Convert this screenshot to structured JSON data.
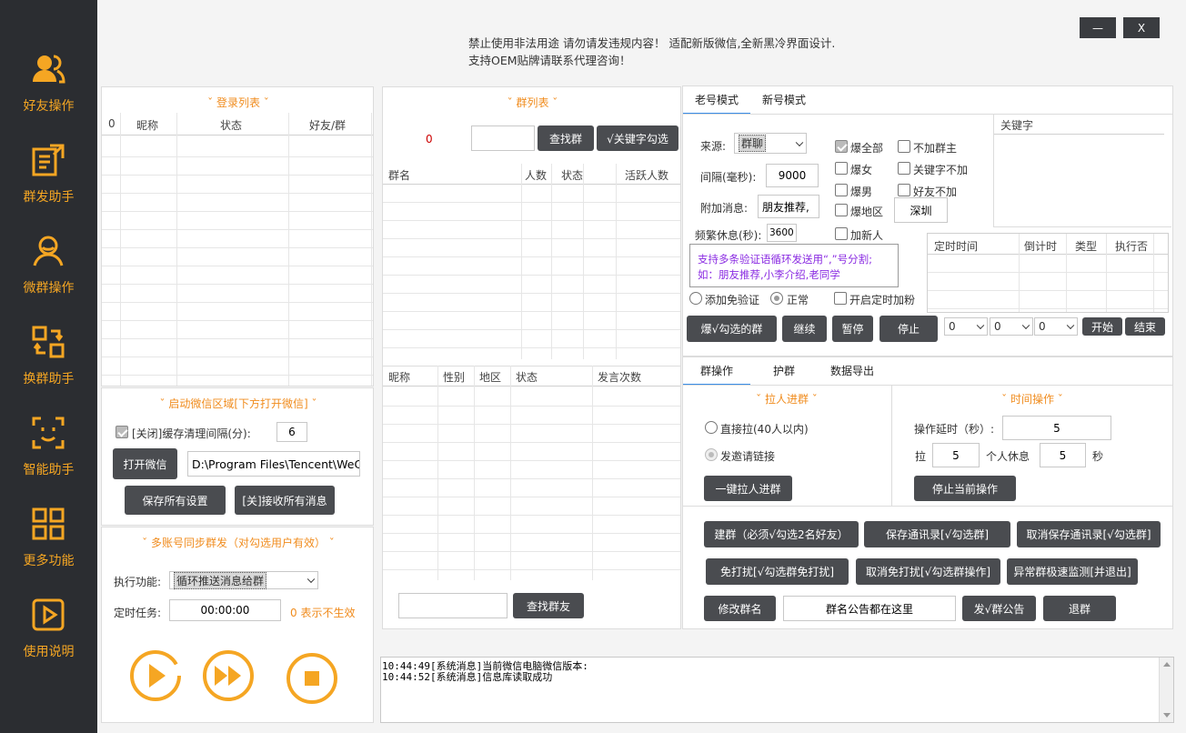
{
  "sidebar": {
    "items": [
      {
        "label": "好友操作",
        "icon": "users-icon"
      },
      {
        "label": "群发助手",
        "icon": "broadcast-icon"
      },
      {
        "label": "微群操作",
        "icon": "group-icon"
      },
      {
        "label": "换群助手",
        "icon": "swap-icon"
      },
      {
        "label": "智能助手",
        "icon": "smart-icon"
      },
      {
        "label": "更多功能",
        "icon": "grid-icon"
      },
      {
        "label": "使用说明",
        "icon": "play-icon"
      }
    ]
  },
  "header": {
    "notice_line1": "禁止使用非法用途 请勿请发违规内容！ 适配新版微信,全新黑冷界面设计.",
    "notice_line2": "支持OEM贴牌请联系代理咨询！",
    "minimize": "—",
    "close": "X"
  },
  "login": {
    "title": "ˇ 登录列表 ˇ",
    "col0": "0",
    "col1": "昵称",
    "col2": "状态",
    "col3": "好友/群"
  },
  "launch": {
    "title": "ˇ 启动微信区域[下方打开微信] ˇ",
    "cache_label": "[关闭]缓存清理间隔(分):",
    "cache_value": "6",
    "open_btn": "打开微信",
    "path": "D:\\Program Files\\Tencent\\WeChat",
    "save_btn": "保存所有设置",
    "recv_btn": "[关]接收所有消息"
  },
  "multi": {
    "title": "ˇ 多账号同步群发（对勾选用户有效） ˇ",
    "func_label": "执行功能:",
    "func_value": "循环推送消息给群",
    "timer_label": "定时任务:",
    "timer_value": "00:00:00",
    "timer_hint": "0 表示不生效"
  },
  "grouplist": {
    "title": "ˇ 群列表 ˇ",
    "count": "0",
    "find_btn": "查找群",
    "kw_btn": "√关键字勾选",
    "col1": "群名",
    "col2": "人数",
    "col3": "状态",
    "col4": "活跃人数"
  },
  "members": {
    "col1": "昵称",
    "col2": "性别",
    "col3": "地区",
    "col4": "状态",
    "col5": "发言次数",
    "find_btn": "查找群友"
  },
  "mode_tabs": {
    "old": "老号模式",
    "new": "新号模式"
  },
  "old_mode": {
    "source_label": "来源:",
    "source_value": "群聊",
    "interval_label": "间隔(毫秒):",
    "interval_value": "9000",
    "extra_label": "附加消息:",
    "extra_value": "朋友推荐,",
    "rest_label": "频繁休息(秒):",
    "rest_value": "3600",
    "opt_all": "爆全部",
    "opt_female": "爆女",
    "opt_male": "爆男",
    "opt_region": "爆地区",
    "opt_newbie": "加新人",
    "opt_no_owner": "不加群主",
    "opt_kw_no": "关键字不加",
    "opt_friend_no": "好友不加",
    "region_value": "深圳",
    "kw_header": "关键字",
    "tip_line1": "支持多条验证语循环发送用“,”号分割;",
    "tip_line2": "如：朋友推荐,小李介绍,老同学",
    "radio_free": "添加免验证",
    "radio_normal": "正常",
    "timed_add": "开启定时加粉",
    "btn_blast": "爆√勾选的群",
    "btn_continue": "继续",
    "btn_pause": "暂停",
    "btn_stop": "停止",
    "sched_cols": [
      "定时时间",
      "倒计时",
      "类型",
      "执行否"
    ],
    "sel_h": "0",
    "sel_m": "0",
    "sel_s": "0",
    "btn_start": "开始",
    "btn_end": "结束"
  },
  "ops_tabs": {
    "group": "群操作",
    "protect": "护群",
    "export": "数据导出"
  },
  "ops": {
    "pull_title": "ˇ 拉人进群 ˇ",
    "time_title": "ˇ 时间操作 ˇ",
    "direct": "直接拉(40人以内)",
    "invite": "发邀请链接",
    "btn_pull": "一键拉人进群",
    "delay_label": "操作延时（秒）:",
    "delay_value": "5",
    "pull_label": "拉",
    "pull_value": "5",
    "rest_label": "个人休息",
    "rest_value": "5",
    "sec": "秒",
    "btn_stop_op": "停止当前操作",
    "btn_create": "建群（必须√勾选2名好友）",
    "btn_save_contact": "保存通讯录[√勾选群]",
    "btn_cancel_contact": "取消保存通讯录[√勾选群]",
    "btn_dnd": "免打扰[√勾选群免打扰]",
    "btn_cancel_dnd": "取消免打扰[√勾选群操作]",
    "btn_monitor": "异常群极速监测[并退出]",
    "btn_rename": "修改群名",
    "notice_value": "群名公告都在这里",
    "btn_notice": "发√群公告",
    "btn_quit": "退群"
  },
  "log": {
    "line1": "10:44:49[系统消息]当前微信电脑微信版本:",
    "line2": "10:44:52[系统消息]信息库读取成功"
  },
  "colors": {
    "accent": "#f5a623",
    "sidebar": "#2b2d31",
    "button": "#4a4c50"
  }
}
